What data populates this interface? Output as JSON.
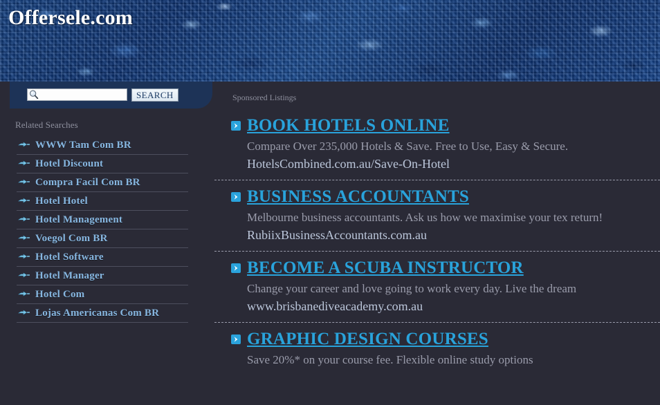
{
  "header": {
    "logo": "Offersele.com",
    "background_color": "#164084"
  },
  "search": {
    "value": "",
    "placeholder": "",
    "button_label": "SEARCH",
    "icon": "magnifier-icon",
    "panel_color": "#1d3357"
  },
  "sidebar": {
    "heading": "Related Searches",
    "bullet_icon": "arrow-bullet-icon",
    "link_color": "#86b6e0",
    "items": [
      {
        "label": "WWW Tam Com BR"
      },
      {
        "label": "Hotel Discount"
      },
      {
        "label": "Compra Facil Com BR"
      },
      {
        "label": "Hotel Hotel"
      },
      {
        "label": "Hotel Management"
      },
      {
        "label": "Voegol Com BR"
      },
      {
        "label": "Hotel Software"
      },
      {
        "label": "Hotel Manager"
      },
      {
        "label": "Hotel Com"
      },
      {
        "label": "Lojas Americanas Com BR"
      }
    ]
  },
  "main": {
    "sponsored_label": "Sponsored Listings",
    "title_color": "#29a3db",
    "listing_icon": "chevron-right-icon",
    "listings": [
      {
        "title": "BOOK HOTELS ONLINE",
        "description": "Compare Over 235,000 Hotels & Save. Free to Use, Easy & Secure.",
        "url": "HotelsCombined.com.au/Save-On-Hotel"
      },
      {
        "title": "BUSINESS ACCOUNTANTS",
        "description": "Melbourne business accountants. Ask us how we maximise your tex return!",
        "url": "RubiixBusinessAccountants.com.au"
      },
      {
        "title": "BECOME A SCUBA INSTRUCTOR",
        "description": "Change your career and love going to work every day. Live the dream",
        "url": "www.brisbanediveacademy.com.au"
      },
      {
        "title": "GRAPHIC DESIGN COURSES",
        "description": "Save 20%* on your course fee. Flexible online study options",
        "url": ""
      }
    ]
  }
}
